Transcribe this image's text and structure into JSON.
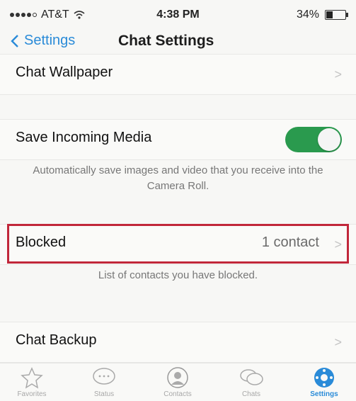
{
  "status_bar": {
    "carrier": "AT&T",
    "time": "4:38 PM",
    "battery": "34%",
    "battery_level": 0.34
  },
  "nav": {
    "back_label": "Settings",
    "title": "Chat Settings"
  },
  "rows": {
    "wallpaper": {
      "label": "Chat Wallpaper"
    },
    "media": {
      "label": "Save Incoming Media",
      "toggle_on": true,
      "description": "Automatically save images and video that you receive into the Camera Roll."
    },
    "blocked": {
      "label": "Blocked",
      "value": "1 contact",
      "description": "List of contacts you have blocked."
    },
    "backup": {
      "label": "Chat Backup"
    }
  },
  "tabs": [
    {
      "label": "Favorites",
      "icon": "star-icon"
    },
    {
      "label": "Status",
      "icon": "speech-bubble-icon"
    },
    {
      "label": "Contacts",
      "icon": "contact-icon"
    },
    {
      "label": "Chats",
      "icon": "chats-icon"
    },
    {
      "label": "Settings",
      "icon": "settings-icon",
      "active": true
    }
  ],
  "colors": {
    "accent": "#2a8bd8",
    "toggle_on": "#2a9a4e",
    "highlight": "#c1273a"
  }
}
